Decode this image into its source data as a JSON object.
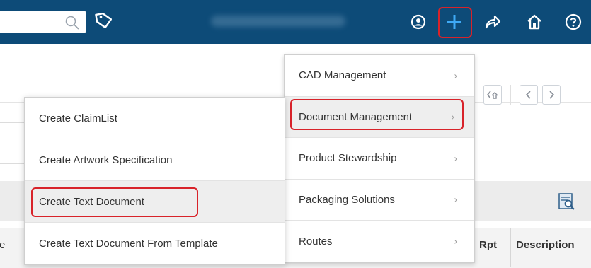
{
  "topbar": {
    "bg": "#0d4b78",
    "search": {
      "placeholder": "",
      "icon": "search-icon"
    },
    "icons": [
      "tag-icon",
      "user-icon",
      "plus-icon",
      "share-icon",
      "home-icon",
      "help-icon"
    ]
  },
  "main_menu": {
    "items": [
      {
        "label": "CAD Management",
        "chevron": "›"
      },
      {
        "label": "Document Management",
        "chevron": "›"
      },
      {
        "label": "Product Stewardship",
        "chevron": "›"
      },
      {
        "label": "Packaging Solutions",
        "chevron": "›"
      },
      {
        "label": "Routes",
        "chevron": "›"
      }
    ]
  },
  "submenu": {
    "items": [
      {
        "label": "Create ClaimList"
      },
      {
        "label": "Create Artwork Specification"
      },
      {
        "label": "Create Text Document"
      },
      {
        "label": "Create Text Document From Template"
      }
    ]
  },
  "table": {
    "columns": {
      "rpt": "Rpt",
      "description": "Description",
      "partial": "e"
    }
  },
  "highlight_color": "#d8232a"
}
